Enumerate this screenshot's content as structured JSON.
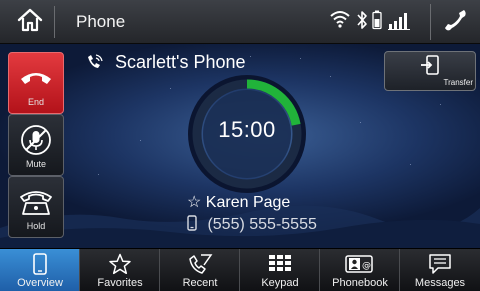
{
  "header": {
    "title": "Phone",
    "icons": [
      "home-icon",
      "wifi-icon",
      "bluetooth-icon",
      "battery-icon",
      "signal-icon",
      "phone-icon"
    ]
  },
  "call": {
    "device_name": "Scarlett's Phone",
    "timer": "15:00",
    "timer_progress": 0.22,
    "contact_name": "Karen Page",
    "contact_number": "(555) 555-5555"
  },
  "side_buttons": {
    "end": "End",
    "mute": "Mute",
    "hold": "Hold"
  },
  "transfer": {
    "label": "Transfer"
  },
  "tabs": [
    {
      "label": "Overview",
      "icon": "smartphone-icon",
      "active": true
    },
    {
      "label": "Favorites",
      "icon": "star-icon",
      "active": false
    },
    {
      "label": "Recent",
      "icon": "recent-calls-icon",
      "active": false
    },
    {
      "label": "Keypad",
      "icon": "keypad-icon",
      "active": false
    },
    {
      "label": "Phonebook",
      "icon": "phonebook-icon",
      "active": false
    },
    {
      "label": "Messages",
      "icon": "message-icon",
      "active": false
    }
  ],
  "colors": {
    "end_red": "#d8262d",
    "active_tab_blue": "#2f7fc8",
    "progress_green": "#21b33a"
  }
}
